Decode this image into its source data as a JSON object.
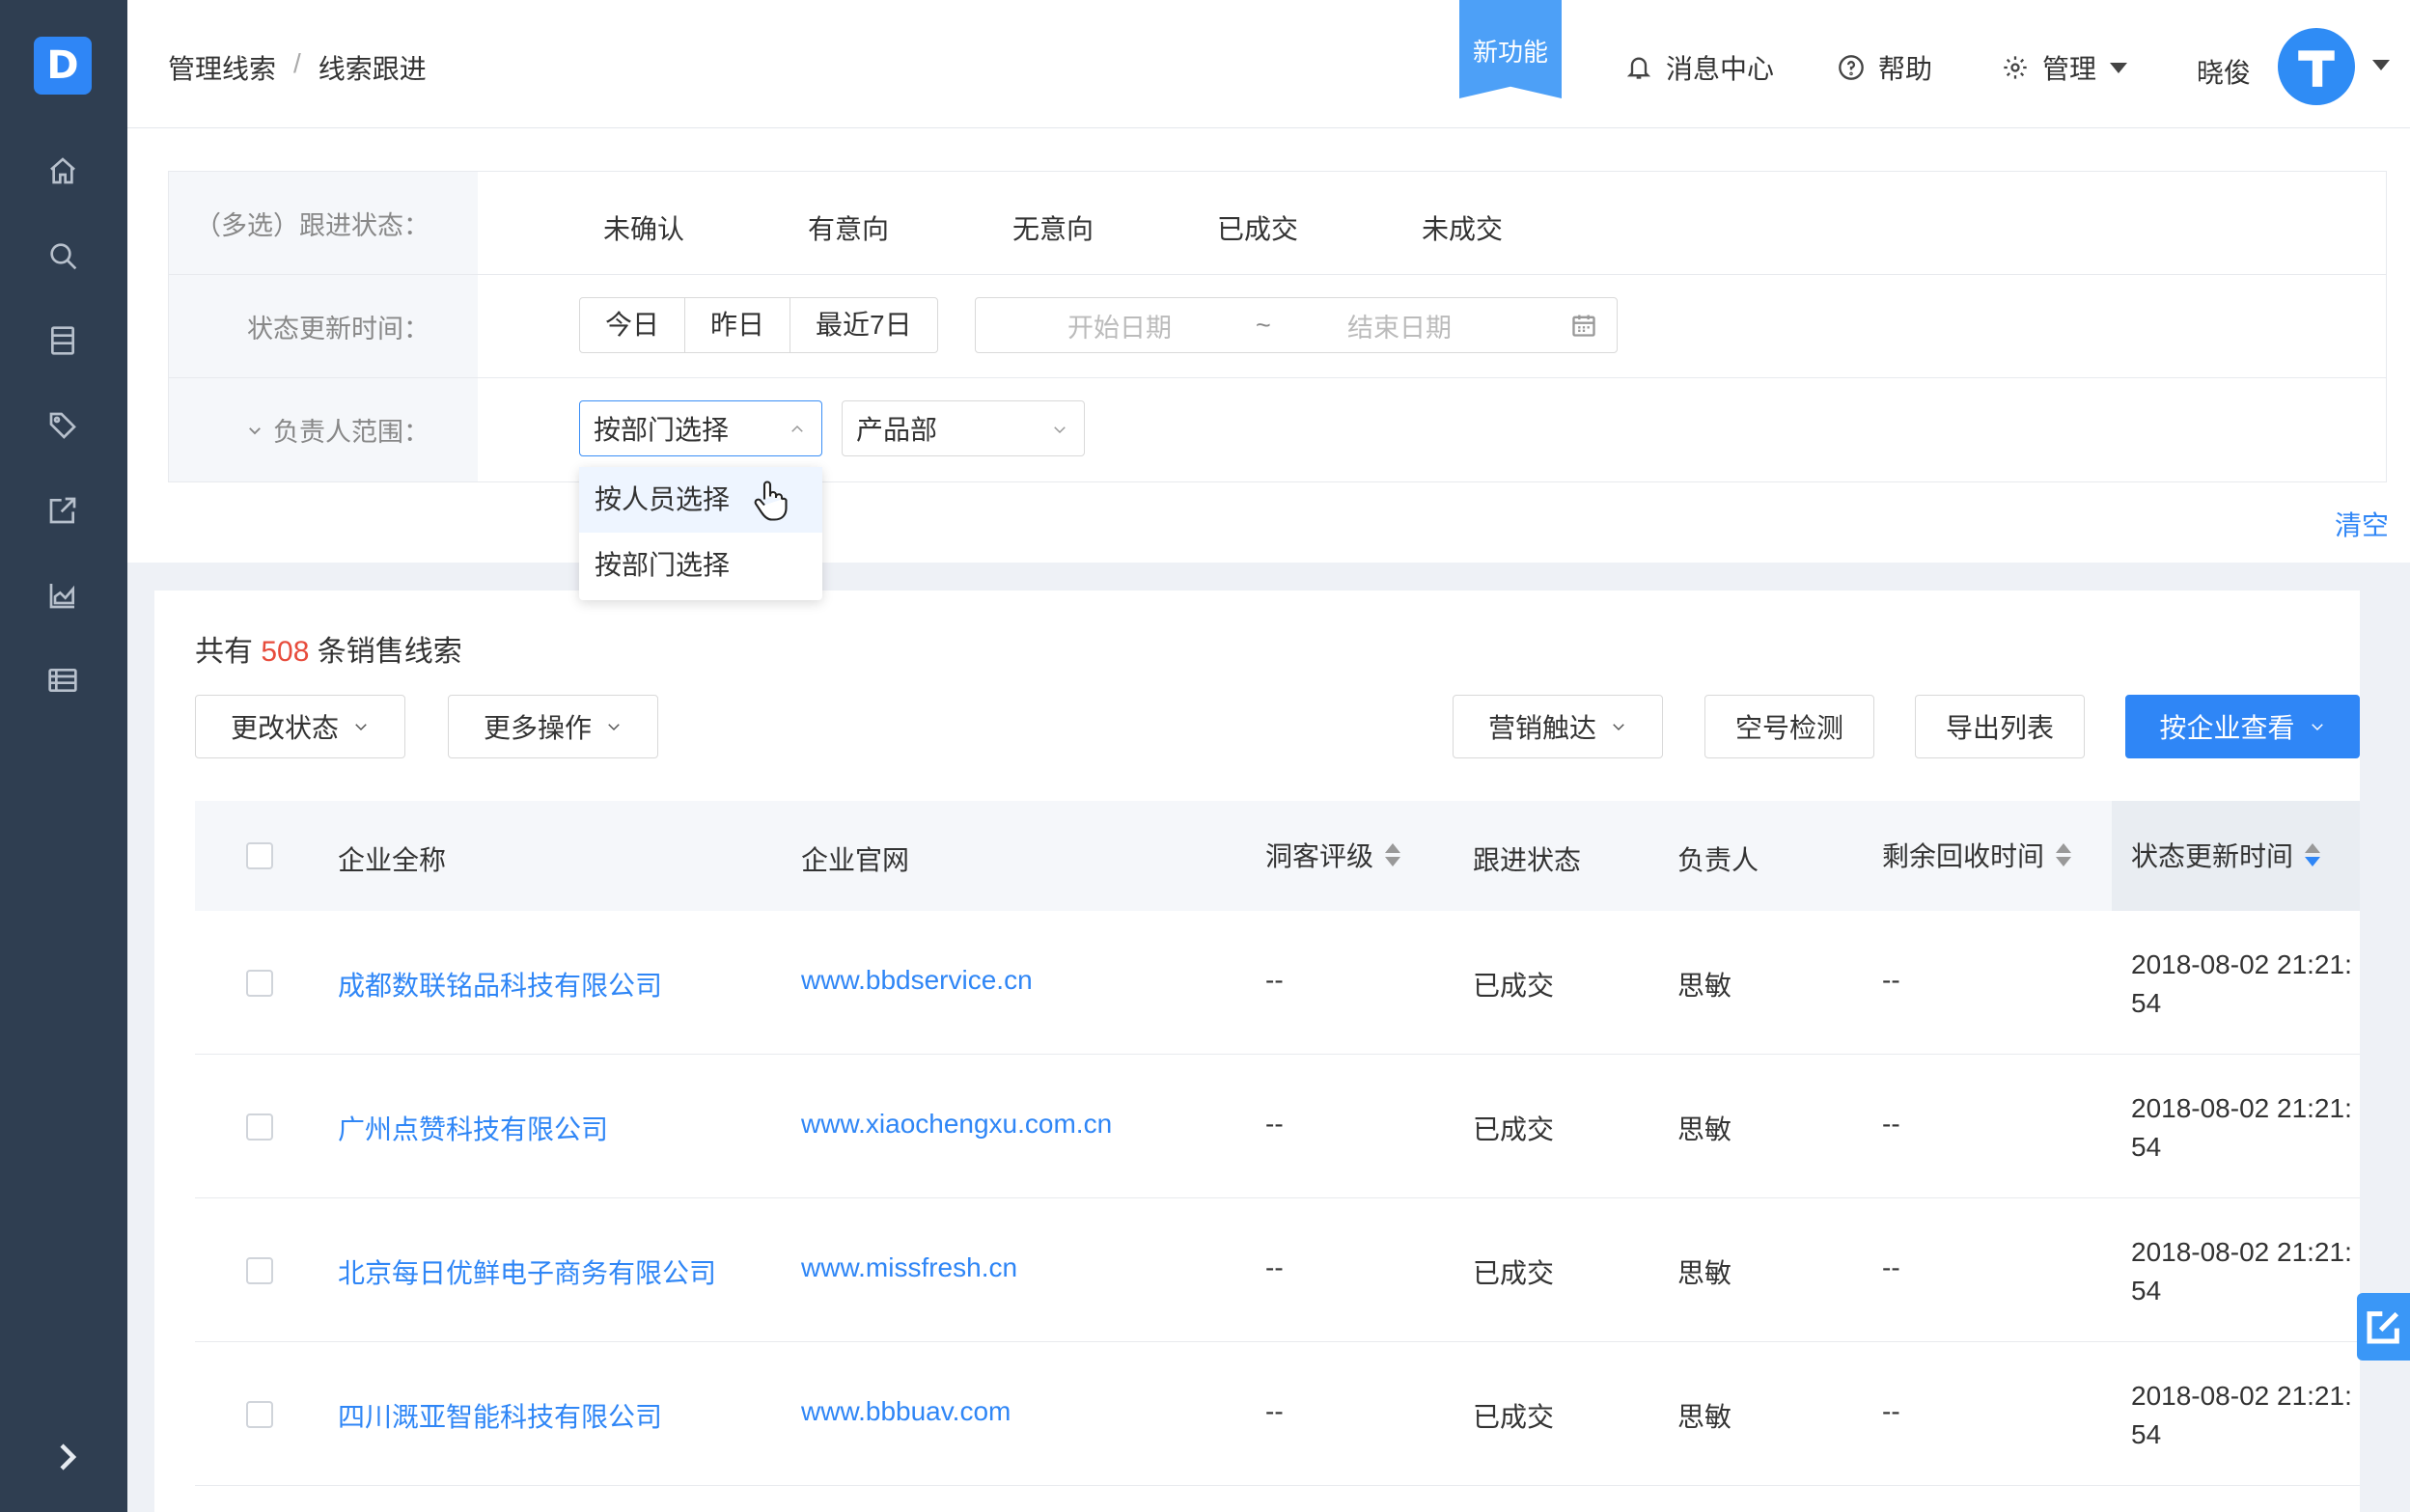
{
  "sidebar": {
    "logo_letter": "D",
    "nav": [
      "home-icon",
      "search-icon",
      "document-icon",
      "tag-icon",
      "share-icon",
      "chart-icon",
      "list-icon"
    ],
    "expand_icon": "chevron-right-icon"
  },
  "header": {
    "breadcrumb": [
      "管理线索",
      "线索跟进"
    ],
    "breadcrumb_sep": "/",
    "new_feature": "新功能",
    "messages": "消息中心",
    "help": "帮助",
    "manage": "管理",
    "user": "晓俊"
  },
  "filters": {
    "status_label": "（多选）跟进状态：",
    "status_options": [
      "未确认",
      "有意向",
      "无意向",
      "已成交",
      "未成交"
    ],
    "time_label": "状态更新时间：",
    "time_buttons": [
      "今日",
      "昨日",
      "最近7日"
    ],
    "start_placeholder": "开始日期",
    "range_sep": "~",
    "end_placeholder": "结束日期",
    "owner_label": "负责人范围：",
    "owner_mode": "按部门选择",
    "department": "产品部",
    "dropdown_options": [
      "按人员选择",
      "按部门选择"
    ],
    "clear": "清空"
  },
  "list": {
    "summary_prefix": "共有",
    "count": "508",
    "summary_suffix": "条销售线索",
    "buttons": {
      "change_status": "更改状态",
      "more_actions": "更多操作",
      "marketing": "营销触达",
      "empty_check": "空号检测",
      "export": "导出列表",
      "by_company": "按企业查看"
    },
    "columns": [
      "企业全称",
      "企业官网",
      "洞客评级",
      "跟进状态",
      "负责人",
      "剩余回收时间",
      "状态更新时间"
    ],
    "rows": [
      {
        "company": "成都数联铭品科技有限公司",
        "website": "www.bbdservice.cn",
        "rating": "--",
        "status": "已成交",
        "owner": "思敏",
        "remaining": "--",
        "updated": "2018-08-02 21:21:54"
      },
      {
        "company": "广州点赞科技有限公司",
        "website": "www.xiaochengxu.com.cn",
        "rating": "--",
        "status": "已成交",
        "owner": "思敏",
        "remaining": "--",
        "updated": "2018-08-02 21:21:54"
      },
      {
        "company": "北京每日优鲜电子商务有限公司",
        "website": "www.missfresh.cn",
        "rating": "--",
        "status": "已成交",
        "owner": "思敏",
        "remaining": "--",
        "updated": "2018-08-02 21:21:54"
      },
      {
        "company": "四川溉亚智能科技有限公司",
        "website": "www.bbbuav.com",
        "rating": "--",
        "status": "已成交",
        "owner": "思敏",
        "remaining": "--",
        "updated": "2018-08-02 21:21:54"
      }
    ]
  },
  "colors": {
    "accent": "#2f86f6",
    "sidebar": "#2f3e51",
    "count": "#e74c3c"
  }
}
